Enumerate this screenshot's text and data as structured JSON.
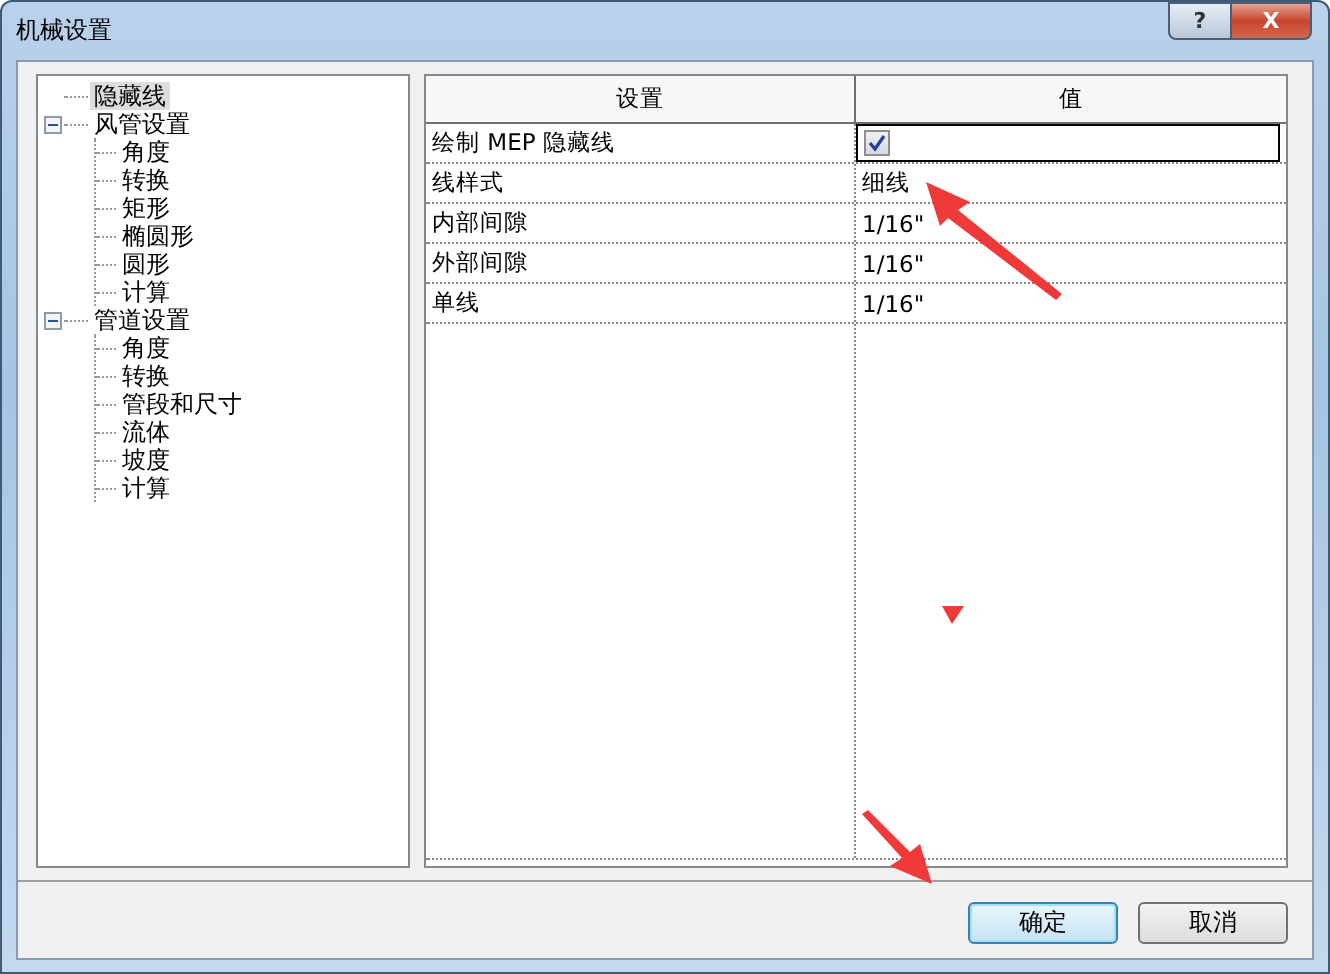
{
  "window": {
    "title": "机械设置",
    "help_button": "?",
    "close_button": "X"
  },
  "tree": [
    {
      "label": "隐藏线",
      "selected": true
    },
    {
      "label": "风管设置",
      "selected": false,
      "expanded": true,
      "children": [
        {
          "label": "角度",
          "selected": false
        },
        {
          "label": "转换",
          "selected": false
        },
        {
          "label": "矩形",
          "selected": false
        },
        {
          "label": "椭圆形",
          "selected": false
        },
        {
          "label": "圆形",
          "selected": false
        },
        {
          "label": "计算",
          "selected": false
        }
      ]
    },
    {
      "label": "管道设置",
      "selected": false,
      "expanded": true,
      "children": [
        {
          "label": "角度",
          "selected": false
        },
        {
          "label": "转换",
          "selected": false
        },
        {
          "label": "管段和尺寸",
          "selected": false
        },
        {
          "label": "流体",
          "selected": false
        },
        {
          "label": "坡度",
          "selected": false
        },
        {
          "label": "计算",
          "selected": false
        }
      ]
    }
  ],
  "table": {
    "columns": [
      "设置",
      "值"
    ],
    "rows": [
      {
        "setting": "绘制 MEP 隐藏线",
        "kind": "checkbox",
        "checked": true,
        "selected": true
      },
      {
        "setting": "线样式",
        "kind": "text",
        "value": "细线",
        "selected": false
      },
      {
        "setting": "内部间隙",
        "kind": "text",
        "value": "1/16\"",
        "selected": false
      },
      {
        "setting": "外部间隙",
        "kind": "text",
        "value": "1/16\"",
        "selected": false
      },
      {
        "setting": "单线",
        "kind": "text",
        "value": "1/16\"",
        "selected": false
      }
    ]
  },
  "buttons": [
    {
      "label": "确定",
      "default": true
    },
    {
      "label": "取消",
      "default": false
    }
  ]
}
